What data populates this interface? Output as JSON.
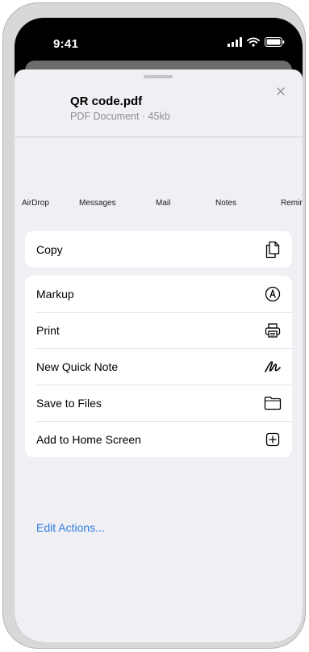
{
  "status_bar": {
    "time": "9:41",
    "icons": [
      "signal-icon",
      "wifi-icon",
      "battery-icon"
    ]
  },
  "file": {
    "name": "QR code.pdf",
    "subtitle": "PDF Document · 45kb"
  },
  "apps": [
    {
      "label": "AirDrop"
    },
    {
      "label": "Messages"
    },
    {
      "label": "Mail"
    },
    {
      "label": "Notes"
    },
    {
      "label": "Remir"
    }
  ],
  "actions_primary": [
    {
      "label": "Copy",
      "icon": "copy-icon"
    }
  ],
  "actions": [
    {
      "label": "Markup",
      "icon": "markup-icon"
    },
    {
      "label": "Print",
      "icon": "print-icon"
    },
    {
      "label": "New Quick Note",
      "icon": "quick-note-icon"
    },
    {
      "label": "Save to Files",
      "icon": "folder-icon"
    },
    {
      "label": "Add to Home Screen",
      "icon": "add-square-icon"
    }
  ],
  "edit_actions": "Edit Actions...",
  "colors": {
    "accent": "#2f7de1",
    "sheet": "#efeff4",
    "separator": "#d1d1d6"
  }
}
